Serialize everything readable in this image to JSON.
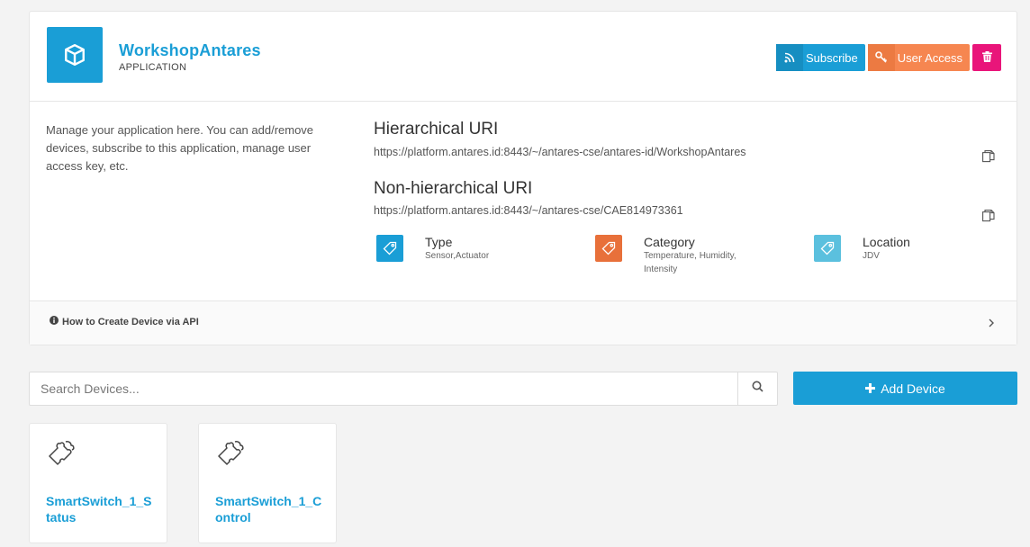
{
  "app": {
    "name": "WorkshopAntares",
    "type_label": "APPLICATION",
    "description": "Manage your application here. You can add/remove devices, subscribe to this application, manage user access key, etc."
  },
  "actions": {
    "subscribe": "Subscribe",
    "user_access": "User Access"
  },
  "uris": {
    "hierarchical_title": "Hierarchical URI",
    "hierarchical_value": "https://platform.antares.id:8443/~/antares-cse/antares-id/WorkshopAntares",
    "nonhierarchical_title": "Non-hierarchical URI",
    "nonhierarchical_value": "https://platform.antares.id:8443/~/antares-cse/CAE814973361"
  },
  "attributes": [
    {
      "label": "Type",
      "value": "Sensor,Actuator",
      "color": "#1a9ed6",
      "icon": "tag-icon"
    },
    {
      "label": "Category",
      "value": "Temperature, Humidity, Intensity",
      "color": "#e8703a",
      "icon": "tag-icon"
    },
    {
      "label": "Location",
      "value": "JDV",
      "color": "#5bc0de",
      "icon": "tag-icon"
    }
  ],
  "howto": {
    "label": "How to Create Device via API"
  },
  "search": {
    "placeholder": "Search Devices..."
  },
  "add_device": {
    "label": "Add Device"
  },
  "devices": [
    {
      "name": "SmartSwitch_1_Status",
      "icon": "puzzle-icon"
    },
    {
      "name": "SmartSwitch_1_Control",
      "icon": "puzzle-icon"
    }
  ],
  "colors": {
    "primary": "#1a9ed6",
    "orange": "#f68650",
    "danger": "#e9157a"
  }
}
